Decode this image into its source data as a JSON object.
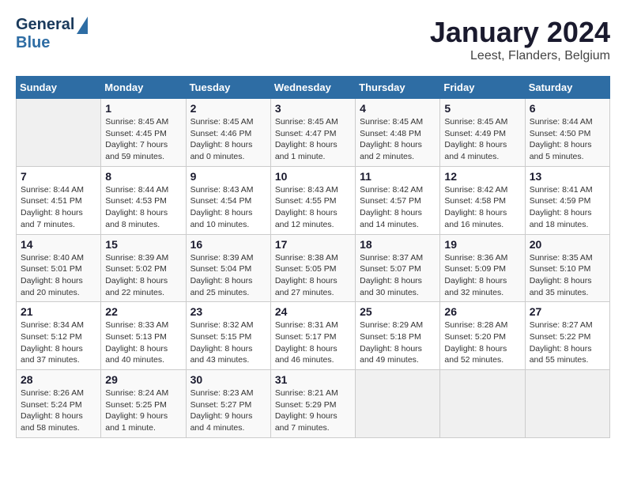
{
  "header": {
    "logo_general": "General",
    "logo_blue": "Blue",
    "main_title": "January 2024",
    "subtitle": "Leest, Flanders, Belgium"
  },
  "weekdays": [
    "Sunday",
    "Monday",
    "Tuesday",
    "Wednesday",
    "Thursday",
    "Friday",
    "Saturday"
  ],
  "weeks": [
    [
      {
        "day": "",
        "sunrise": "",
        "sunset": "",
        "daylight": ""
      },
      {
        "day": "1",
        "sunrise": "Sunrise: 8:45 AM",
        "sunset": "Sunset: 4:45 PM",
        "daylight": "Daylight: 7 hours and 59 minutes."
      },
      {
        "day": "2",
        "sunrise": "Sunrise: 8:45 AM",
        "sunset": "Sunset: 4:46 PM",
        "daylight": "Daylight: 8 hours and 0 minutes."
      },
      {
        "day": "3",
        "sunrise": "Sunrise: 8:45 AM",
        "sunset": "Sunset: 4:47 PM",
        "daylight": "Daylight: 8 hours and 1 minute."
      },
      {
        "day": "4",
        "sunrise": "Sunrise: 8:45 AM",
        "sunset": "Sunset: 4:48 PM",
        "daylight": "Daylight: 8 hours and 2 minutes."
      },
      {
        "day": "5",
        "sunrise": "Sunrise: 8:45 AM",
        "sunset": "Sunset: 4:49 PM",
        "daylight": "Daylight: 8 hours and 4 minutes."
      },
      {
        "day": "6",
        "sunrise": "Sunrise: 8:44 AM",
        "sunset": "Sunset: 4:50 PM",
        "daylight": "Daylight: 8 hours and 5 minutes."
      }
    ],
    [
      {
        "day": "7",
        "sunrise": "Sunrise: 8:44 AM",
        "sunset": "Sunset: 4:51 PM",
        "daylight": "Daylight: 8 hours and 7 minutes."
      },
      {
        "day": "8",
        "sunrise": "Sunrise: 8:44 AM",
        "sunset": "Sunset: 4:53 PM",
        "daylight": "Daylight: 8 hours and 8 minutes."
      },
      {
        "day": "9",
        "sunrise": "Sunrise: 8:43 AM",
        "sunset": "Sunset: 4:54 PM",
        "daylight": "Daylight: 8 hours and 10 minutes."
      },
      {
        "day": "10",
        "sunrise": "Sunrise: 8:43 AM",
        "sunset": "Sunset: 4:55 PM",
        "daylight": "Daylight: 8 hours and 12 minutes."
      },
      {
        "day": "11",
        "sunrise": "Sunrise: 8:42 AM",
        "sunset": "Sunset: 4:57 PM",
        "daylight": "Daylight: 8 hours and 14 minutes."
      },
      {
        "day": "12",
        "sunrise": "Sunrise: 8:42 AM",
        "sunset": "Sunset: 4:58 PM",
        "daylight": "Daylight: 8 hours and 16 minutes."
      },
      {
        "day": "13",
        "sunrise": "Sunrise: 8:41 AM",
        "sunset": "Sunset: 4:59 PM",
        "daylight": "Daylight: 8 hours and 18 minutes."
      }
    ],
    [
      {
        "day": "14",
        "sunrise": "Sunrise: 8:40 AM",
        "sunset": "Sunset: 5:01 PM",
        "daylight": "Daylight: 8 hours and 20 minutes."
      },
      {
        "day": "15",
        "sunrise": "Sunrise: 8:39 AM",
        "sunset": "Sunset: 5:02 PM",
        "daylight": "Daylight: 8 hours and 22 minutes."
      },
      {
        "day": "16",
        "sunrise": "Sunrise: 8:39 AM",
        "sunset": "Sunset: 5:04 PM",
        "daylight": "Daylight: 8 hours and 25 minutes."
      },
      {
        "day": "17",
        "sunrise": "Sunrise: 8:38 AM",
        "sunset": "Sunset: 5:05 PM",
        "daylight": "Daylight: 8 hours and 27 minutes."
      },
      {
        "day": "18",
        "sunrise": "Sunrise: 8:37 AM",
        "sunset": "Sunset: 5:07 PM",
        "daylight": "Daylight: 8 hours and 30 minutes."
      },
      {
        "day": "19",
        "sunrise": "Sunrise: 8:36 AM",
        "sunset": "Sunset: 5:09 PM",
        "daylight": "Daylight: 8 hours and 32 minutes."
      },
      {
        "day": "20",
        "sunrise": "Sunrise: 8:35 AM",
        "sunset": "Sunset: 5:10 PM",
        "daylight": "Daylight: 8 hours and 35 minutes."
      }
    ],
    [
      {
        "day": "21",
        "sunrise": "Sunrise: 8:34 AM",
        "sunset": "Sunset: 5:12 PM",
        "daylight": "Daylight: 8 hours and 37 minutes."
      },
      {
        "day": "22",
        "sunrise": "Sunrise: 8:33 AM",
        "sunset": "Sunset: 5:13 PM",
        "daylight": "Daylight: 8 hours and 40 minutes."
      },
      {
        "day": "23",
        "sunrise": "Sunrise: 8:32 AM",
        "sunset": "Sunset: 5:15 PM",
        "daylight": "Daylight: 8 hours and 43 minutes."
      },
      {
        "day": "24",
        "sunrise": "Sunrise: 8:31 AM",
        "sunset": "Sunset: 5:17 PM",
        "daylight": "Daylight: 8 hours and 46 minutes."
      },
      {
        "day": "25",
        "sunrise": "Sunrise: 8:29 AM",
        "sunset": "Sunset: 5:18 PM",
        "daylight": "Daylight: 8 hours and 49 minutes."
      },
      {
        "day": "26",
        "sunrise": "Sunrise: 8:28 AM",
        "sunset": "Sunset: 5:20 PM",
        "daylight": "Daylight: 8 hours and 52 minutes."
      },
      {
        "day": "27",
        "sunrise": "Sunrise: 8:27 AM",
        "sunset": "Sunset: 5:22 PM",
        "daylight": "Daylight: 8 hours and 55 minutes."
      }
    ],
    [
      {
        "day": "28",
        "sunrise": "Sunrise: 8:26 AM",
        "sunset": "Sunset: 5:24 PM",
        "daylight": "Daylight: 8 hours and 58 minutes."
      },
      {
        "day": "29",
        "sunrise": "Sunrise: 8:24 AM",
        "sunset": "Sunset: 5:25 PM",
        "daylight": "Daylight: 9 hours and 1 minute."
      },
      {
        "day": "30",
        "sunrise": "Sunrise: 8:23 AM",
        "sunset": "Sunset: 5:27 PM",
        "daylight": "Daylight: 9 hours and 4 minutes."
      },
      {
        "day": "31",
        "sunrise": "Sunrise: 8:21 AM",
        "sunset": "Sunset: 5:29 PM",
        "daylight": "Daylight: 9 hours and 7 minutes."
      },
      {
        "day": "",
        "sunrise": "",
        "sunset": "",
        "daylight": ""
      },
      {
        "day": "",
        "sunrise": "",
        "sunset": "",
        "daylight": ""
      },
      {
        "day": "",
        "sunrise": "",
        "sunset": "",
        "daylight": ""
      }
    ]
  ]
}
